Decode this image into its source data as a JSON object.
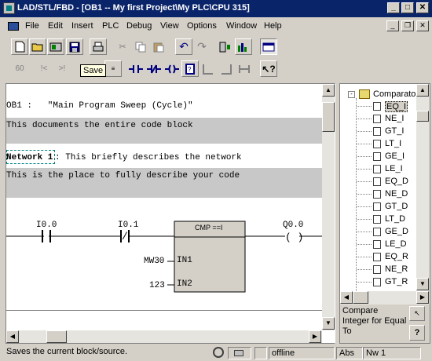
{
  "window": {
    "title": "LAD/STL/FBD  - [OB1 -- My first Project\\My PLC\\CPU 315]"
  },
  "menu": [
    "File",
    "Edit",
    "Insert",
    "PLC",
    "Debug",
    "View",
    "Options",
    "Window",
    "Help"
  ],
  "tooltip": "Save",
  "editor": {
    "block_title": "OB1 :   \"Main Program Sweep (Cycle)\"",
    "block_comment": "This documents the entire code block",
    "network_label": "Network 1",
    "network_title": ": This briefly describes the network",
    "network_comment": "This is the place to fully describe your code",
    "ladder": {
      "contact1": "I0.0",
      "contact2": "I0.1",
      "coil": "Q0.0",
      "box_title": "CMP ==I",
      "in1_label": "IN1",
      "in2_label": "IN2",
      "in1_operand": "MW30",
      "in2_operand": "123",
      "nc_symbol": "/",
      "coil_symbol": "( )"
    }
  },
  "tree": {
    "root": "Comparator",
    "items": [
      "EQ_I",
      "NE_I",
      "GT_I",
      "LT_I",
      "GE_I",
      "LE_I",
      "EQ_D",
      "NE_D",
      "GT_D",
      "LT_D",
      "GE_D",
      "LE_D",
      "EQ_R",
      "NE_R",
      "GT_R"
    ]
  },
  "info": {
    "text": "Compare Integer for Equal To",
    "help": "?"
  },
  "status": {
    "message": "Saves the current block/source.",
    "mode": "offline",
    "abs": "Abs",
    "nw": "Nw 1"
  }
}
